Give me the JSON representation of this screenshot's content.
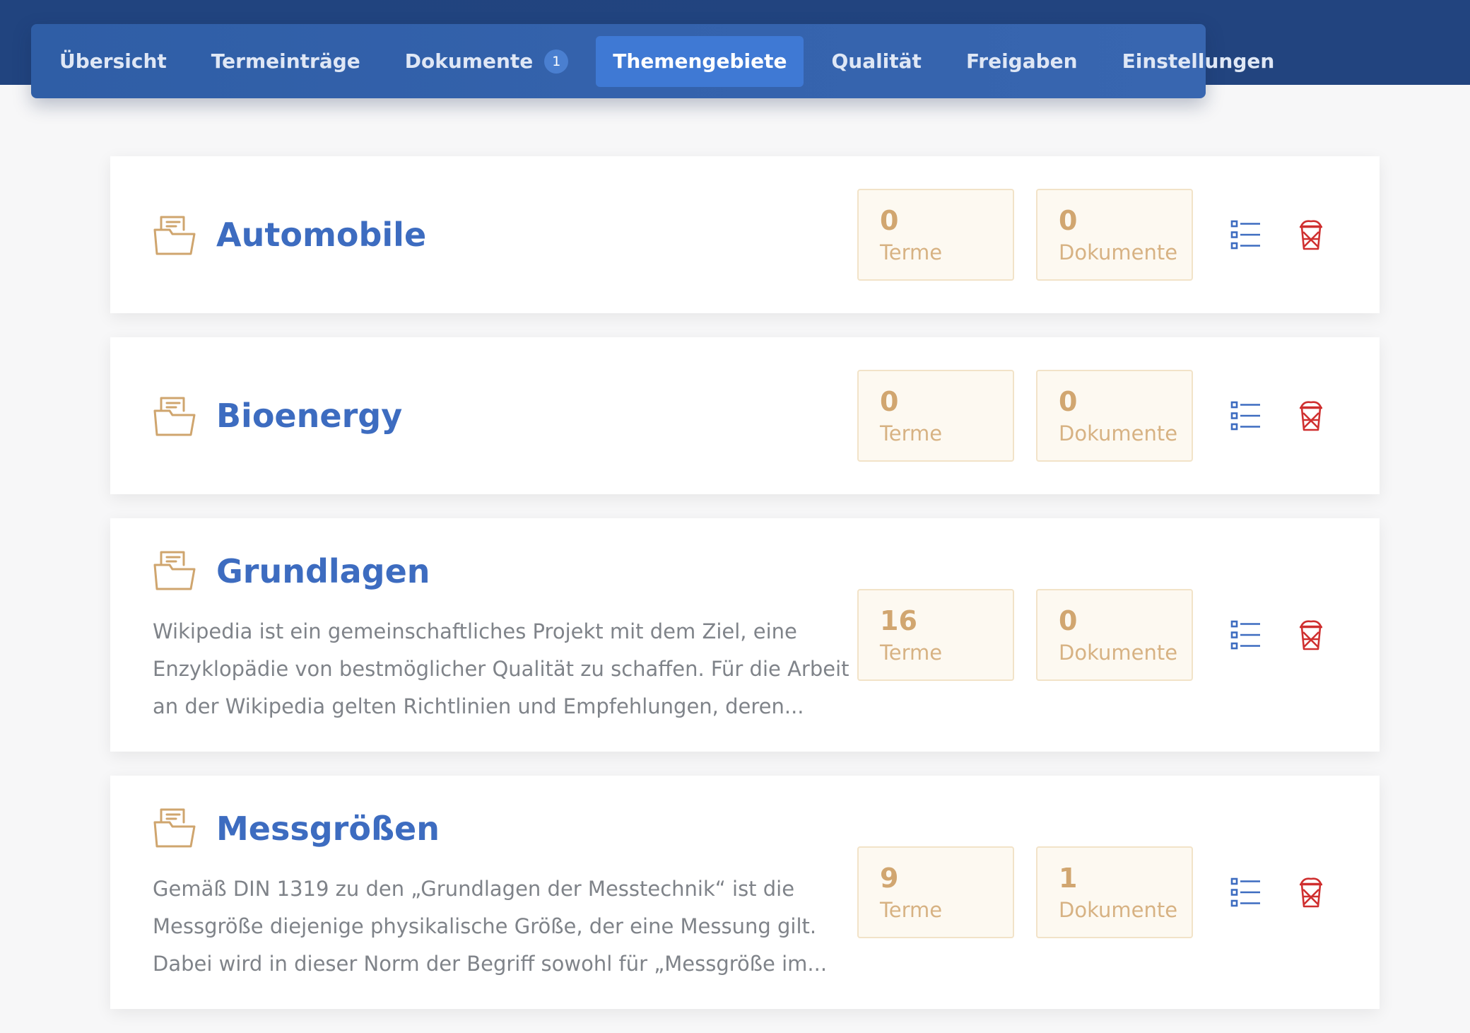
{
  "nav": {
    "tabs": [
      {
        "label": "Übersicht",
        "active": false
      },
      {
        "label": "Termeinträge",
        "active": false
      },
      {
        "label": "Dokumente",
        "badge": "1",
        "active": false
      },
      {
        "label": "Themengebiete",
        "active": true
      },
      {
        "label": "Qualität",
        "active": false
      },
      {
        "label": "Freigaben",
        "active": false
      },
      {
        "label": "Einstellungen",
        "active": false
      }
    ]
  },
  "topics": [
    {
      "title": "Automobile",
      "description": "",
      "terms": {
        "value": "0",
        "label": "Terme"
      },
      "documents": {
        "value": "0",
        "label": "Dokumente"
      }
    },
    {
      "title": "Bioenergy",
      "description": "",
      "terms": {
        "value": "0",
        "label": "Terme"
      },
      "documents": {
        "value": "0",
        "label": "Dokumente"
      }
    },
    {
      "title": "Grundlagen",
      "description": "Wikipedia ist ein gemeinschaftliches Projekt mit dem Ziel, eine Enzyklopädie von bestmöglicher Qualität zu schaffen. Für die Arbeit an der Wikipedia gelten Richtlinien und Empfehlungen, deren...",
      "terms": {
        "value": "16",
        "label": "Terme"
      },
      "documents": {
        "value": "0",
        "label": "Dokumente"
      }
    },
    {
      "title": "Messgrößen",
      "description": "Gemäß DIN 1319 zu den „Grundlagen der Messtechnik“ ist die Messgröße diejenige physikalische Größe, der eine Messung gilt. Dabei wird in dieser Norm der Begriff sowohl für „Messgröße im...",
      "terms": {
        "value": "9",
        "label": "Terme"
      },
      "documents": {
        "value": "1",
        "label": "Dokumente"
      }
    }
  ],
  "icons": {
    "folder": "folder-icon",
    "list": "list-icon",
    "trash": "trash-icon"
  },
  "colors": {
    "header_bg": "#22447f",
    "tabbar_bg": "#3462ac",
    "active_tab": "#3f79d4",
    "title_blue": "#3d6cc0",
    "accent_gold": "#d1a670",
    "stat_bg": "#fdf9f1",
    "trash_red": "#cf2f2f"
  }
}
